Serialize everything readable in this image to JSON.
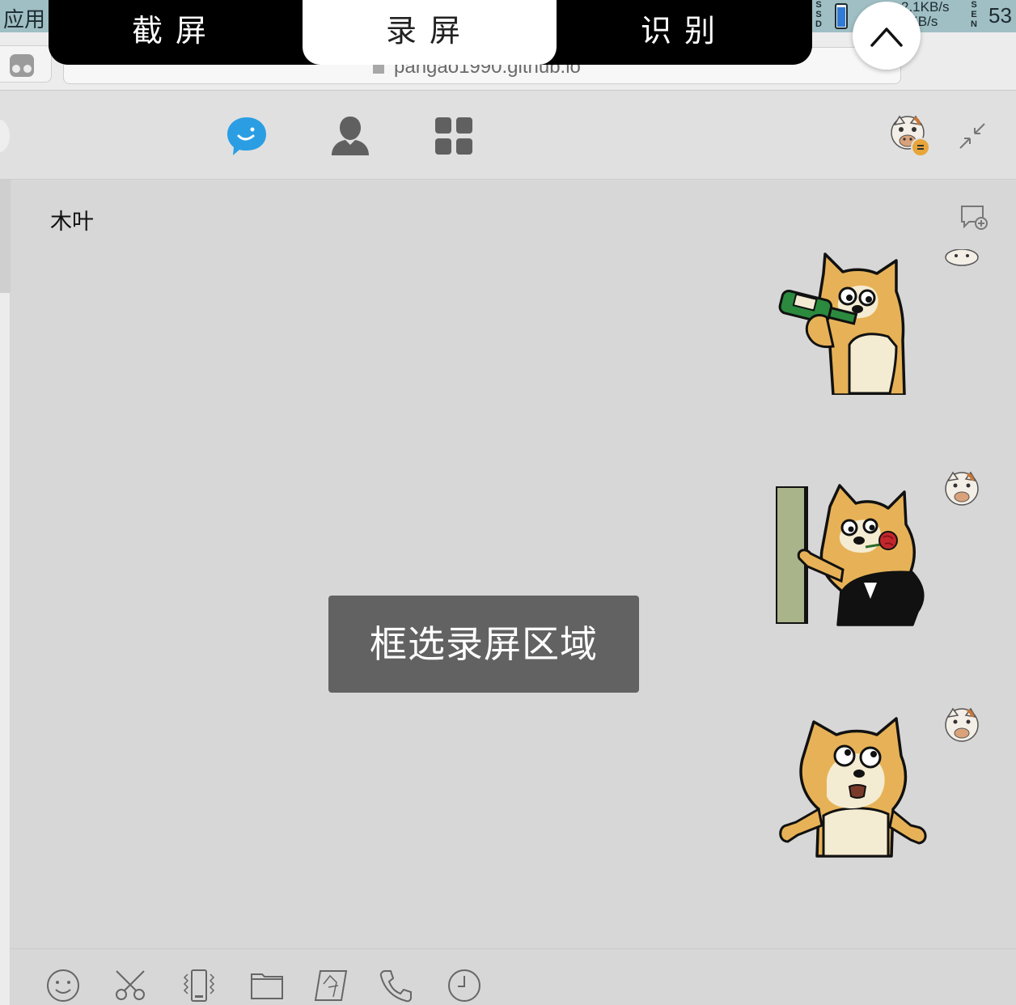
{
  "os_bar": {
    "apps_label": "应用",
    "ssd_label": "SSD",
    "ssd_fill_fraction": 0.85,
    "net_up": "2.1KB/s",
    "net_down": "8KB/s",
    "sen_label": "SEN",
    "cpu_value": "53"
  },
  "browser": {
    "url": "pangao1990.github.io"
  },
  "capture_toolbar": {
    "tabs": [
      {
        "label": "截屏",
        "active": false
      },
      {
        "label": "录屏",
        "active": true
      },
      {
        "label": "识别",
        "active": false
      }
    ],
    "collapse_icon": "chevron-up-icon"
  },
  "chat_app": {
    "nav": [
      {
        "name": "messages",
        "icon": "chat-bubble-icon",
        "active": true,
        "color": "#2b9ee3"
      },
      {
        "name": "contacts",
        "icon": "person-icon",
        "active": false,
        "color": "#606060"
      },
      {
        "name": "apps",
        "icon": "grid-icon",
        "active": false,
        "color": "#606060"
      }
    ],
    "user_status": "busy",
    "contact_name": "木叶",
    "messages": [
      {
        "sender": "self",
        "type": "sticker",
        "sticker": "shiba-drinking-bottle"
      },
      {
        "sender": "self",
        "type": "sticker",
        "sticker": "shiba-tuxedo-rose"
      },
      {
        "sender": "self",
        "type": "sticker",
        "sticker": "shiba-shrug"
      }
    ],
    "toast": "框选录屏区域",
    "composer_tools": [
      {
        "name": "emoji",
        "icon": "smile-icon"
      },
      {
        "name": "screenshot",
        "icon": "scissors-icon"
      },
      {
        "name": "shake",
        "icon": "vibrate-icon"
      },
      {
        "name": "file",
        "icon": "folder-icon"
      },
      {
        "name": "image",
        "icon": "image-icon"
      },
      {
        "name": "voice-call",
        "icon": "phone-icon"
      },
      {
        "name": "history",
        "icon": "clock-icon"
      }
    ]
  },
  "colors": {
    "accent_blue": "#2b9ee3",
    "shiba_orange": "#e7b257",
    "bottle_green": "#2b8a3e",
    "toast_bg": "#626262"
  }
}
